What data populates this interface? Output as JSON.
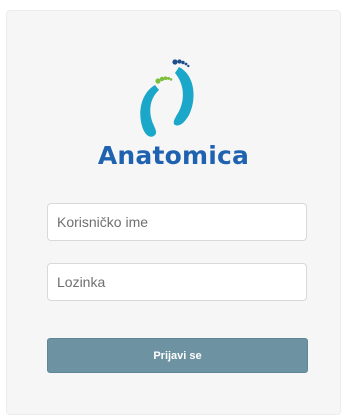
{
  "brand": {
    "name": "Anatomica",
    "icon": "footprints-logo-icon",
    "colors": {
      "text": "#1e62b0",
      "teal": "#1aa7c9",
      "green": "#7cbe3a"
    }
  },
  "form": {
    "username_placeholder": "Korisničko ime",
    "username_value": "",
    "password_placeholder": "Lozinka",
    "password_value": "",
    "submit_label": "Prijavi se",
    "submit_color": "#6d93a2"
  }
}
